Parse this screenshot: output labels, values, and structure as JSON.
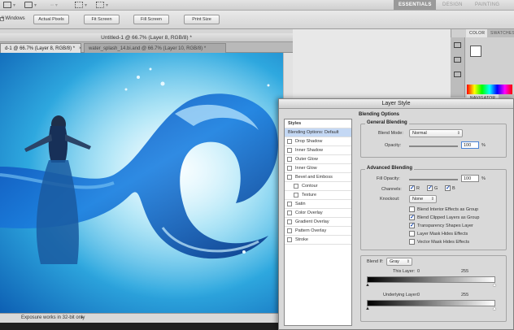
{
  "app_bar": {
    "icons": [
      "frame-icon",
      "view-icon",
      "zoom-icon",
      "arrange-icon",
      "screen-mode-icon"
    ],
    "workspaces": [
      {
        "label": "ESSENTIALS",
        "active": true
      },
      {
        "label": "DESIGN",
        "active": false
      },
      {
        "label": "PAINTING",
        "active": false
      }
    ]
  },
  "options_bar": {
    "left_label": "ll Windows",
    "buttons": [
      "Actual Pixels",
      "Fit Screen",
      "Fill Screen",
      "Print Size"
    ]
  },
  "document": {
    "window_title": "Untitled-1 @ 66.7% (Layer 8, RGB/8) *",
    "tabs": [
      {
        "label": "d-1 @ 66.7% (Layer 8, RGB/8) *",
        "active": true
      },
      {
        "label": "water_splash_14.bi.and @ 66.7% (Layer 10, RGB/8) *",
        "active": false
      }
    ],
    "status_zoom": "",
    "status_text": "Exposure works in 32-bit only"
  },
  "panels": {
    "color_tab": "COLOR",
    "swatches_tab": "SWATCHES",
    "navigator_tab": "NAVIGATOR",
    "foreground_color": "#ffffff",
    "background_color": "#000000"
  },
  "layer_style": {
    "title": "Layer Style",
    "styles_header": "Styles",
    "styles": [
      {
        "label": "Blending Options: Default",
        "active": true,
        "checkbox": false,
        "indent": false
      },
      {
        "label": "Drop Shadow",
        "checkbox": true,
        "indent": false
      },
      {
        "label": "Inner Shadow",
        "checkbox": true,
        "indent": false
      },
      {
        "label": "Outer Glow",
        "checkbox": true,
        "indent": false
      },
      {
        "label": "Inner Glow",
        "checkbox": true,
        "indent": false
      },
      {
        "label": "Bevel and Emboss",
        "checkbox": true,
        "indent": false
      },
      {
        "label": "Contour",
        "checkbox": true,
        "indent": true
      },
      {
        "label": "Texture",
        "checkbox": true,
        "indent": true
      },
      {
        "label": "Satin",
        "checkbox": true,
        "indent": false
      },
      {
        "label": "Color Overlay",
        "checkbox": true,
        "indent": false
      },
      {
        "label": "Gradient Overlay",
        "checkbox": true,
        "indent": false
      },
      {
        "label": "Pattern Overlay",
        "checkbox": true,
        "indent": false
      },
      {
        "label": "Stroke",
        "checkbox": true,
        "indent": false
      }
    ],
    "blending_options_title": "Blending Options",
    "general_title": "General Blending",
    "blend_mode_label": "Blend Mode:",
    "blend_mode_value": "Normal",
    "opacity_label": "Opacity:",
    "opacity_value": "100",
    "percent": "%",
    "advanced_title": "Advanced Blending",
    "fill_opacity_label": "Fill Opacity:",
    "fill_opacity_value": "100",
    "channels_label": "Channels:",
    "channels": [
      {
        "label": "R",
        "checked": true
      },
      {
        "label": "G",
        "checked": true
      },
      {
        "label": "B",
        "checked": true
      }
    ],
    "knockout_label": "Knockout:",
    "knockout_value": "None",
    "options": [
      {
        "label": "Blend Interior Effects as Group",
        "checked": false
      },
      {
        "label": "Blend Clipped Layers as Group",
        "checked": true
      },
      {
        "label": "Transparency Shapes Layer",
        "checked": true
      },
      {
        "label": "Layer Mask Hides Effects",
        "checked": false
      },
      {
        "label": "Vector Mask Hides Effects",
        "checked": false
      }
    ],
    "blend_if_label": "Blend If:",
    "blend_if_value": "Gray",
    "this_layer_label": "This Layer:",
    "this_layer_min": "0",
    "this_layer_max": "255",
    "underlying_label": "Underlying Layer:",
    "underlying_min": "0",
    "underlying_max": "255"
  }
}
